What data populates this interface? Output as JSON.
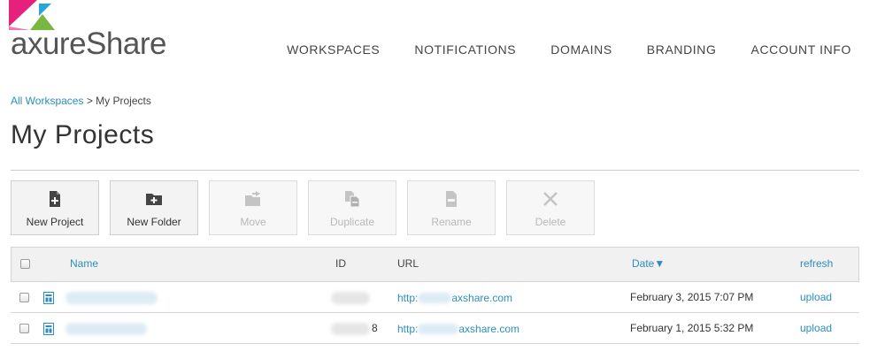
{
  "brand": {
    "logo_text": "axureShare",
    "colors": {
      "pink": "#e5217b",
      "green": "#7ab740",
      "teal": "#2aa6d6",
      "accent": "#2a8fbd"
    }
  },
  "nav": {
    "items": [
      {
        "label": "WORKSPACES"
      },
      {
        "label": "NOTIFICATIONS"
      },
      {
        "label": "DOMAINS"
      },
      {
        "label": "BRANDING"
      },
      {
        "label": "ACCOUNT INFO"
      }
    ]
  },
  "breadcrumb": {
    "parent": "All Workspaces",
    "separator": " > ",
    "current": "My Projects"
  },
  "page": {
    "title": "My Projects"
  },
  "toolbar": {
    "new_project": {
      "label": "New Project",
      "icon": "new-file-icon",
      "enabled": true
    },
    "new_folder": {
      "label": "New Folder",
      "icon": "new-folder-icon",
      "enabled": true
    },
    "move": {
      "label": "Move",
      "icon": "move-folder-icon",
      "enabled": false
    },
    "duplicate": {
      "label": "Duplicate",
      "icon": "duplicate-icon",
      "enabled": false
    },
    "rename": {
      "label": "Rename",
      "icon": "rename-icon",
      "enabled": false
    },
    "delete": {
      "label": "Delete",
      "icon": "delete-x-icon",
      "enabled": false
    }
  },
  "table": {
    "columns": {
      "name": "Name",
      "id": "ID",
      "url": "URL",
      "date": "Date",
      "sort_indicator": "▼",
      "refresh": "refresh"
    },
    "rows": [
      {
        "id_suffix": "",
        "url_prefix": "http:",
        "url_suffix": "axshare.com",
        "date": "February 3, 2015 7:07 PM",
        "action": "upload"
      },
      {
        "id_suffix": "8",
        "url_prefix": "http:",
        "url_suffix": "axshare.com",
        "date": "February 1, 2015 5:32 PM",
        "action": "upload"
      }
    ]
  }
}
